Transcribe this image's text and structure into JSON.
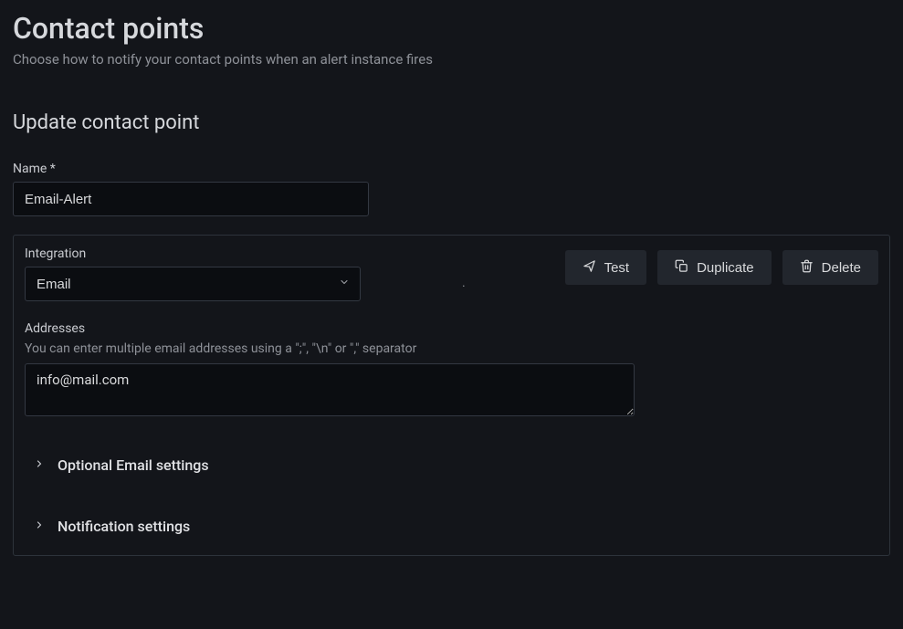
{
  "page": {
    "title": "Contact points",
    "subtitle": "Choose how to notify your contact points when an alert instance fires"
  },
  "section": {
    "heading": "Update contact point"
  },
  "form": {
    "name_label": "Name *",
    "name_value": "Email-Alert",
    "integration_label": "Integration",
    "integration_value": "Email",
    "addresses_label": "Addresses",
    "addresses_help": "You can enter multiple email addresses using a \";\", \"\\n\" or \",\" separator",
    "addresses_value": "info@mail.com"
  },
  "buttons": {
    "test": "Test",
    "duplicate": "Duplicate",
    "delete": "Delete"
  },
  "collapsibles": {
    "optional_email": "Optional Email settings",
    "notification": "Notification settings"
  }
}
